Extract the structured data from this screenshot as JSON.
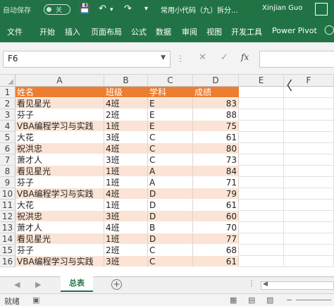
{
  "titlebar": {
    "autosave_label": "自动保存",
    "autosave_state": "关",
    "doc_title": "常用小代码（九）拆分...",
    "user": "Xinjian Guo"
  },
  "ribbon": {
    "tabs": [
      "文件",
      "开始",
      "插入",
      "页面布局",
      "公式",
      "数据",
      "审阅",
      "视图",
      "开发工具",
      "Power Pivot"
    ]
  },
  "formula_bar": {
    "name_box": "F6",
    "formula": ""
  },
  "grid": {
    "columns": [
      "A",
      "B",
      "C",
      "D",
      "E",
      "F"
    ],
    "header_row": [
      "姓名",
      "班级",
      "学科",
      "成绩"
    ],
    "rows": [
      [
        "看见星光",
        "4班",
        "E",
        "83"
      ],
      [
        "芬子",
        "2班",
        "E",
        "88"
      ],
      [
        "VBA编程学习与实践",
        "1班",
        "E",
        "75"
      ],
      [
        "大花",
        "3班",
        "C",
        "61"
      ],
      [
        "祝洪忠",
        "4班",
        "C",
        "80"
      ],
      [
        "萧才人",
        "3班",
        "C",
        "73"
      ],
      [
        "看见星光",
        "1班",
        "A",
        "84"
      ],
      [
        "芬子",
        "1班",
        "A",
        "71"
      ],
      [
        "VBA编程学习与实践",
        "4班",
        "D",
        "79"
      ],
      [
        "大花",
        "1班",
        "D",
        "61"
      ],
      [
        "祝洪忠",
        "3班",
        "D",
        "60"
      ],
      [
        "萧才人",
        "4班",
        "B",
        "70"
      ],
      [
        "看见星光",
        "1班",
        "D",
        "77"
      ],
      [
        "芬子",
        "2班",
        "C",
        "68"
      ],
      [
        "VBA编程学习与实践",
        "3班",
        "C",
        "61"
      ]
    ]
  },
  "sheets": {
    "tabs": [
      "总表"
    ],
    "add_label": "+"
  },
  "statusbar": {
    "ready": "就绪"
  }
}
